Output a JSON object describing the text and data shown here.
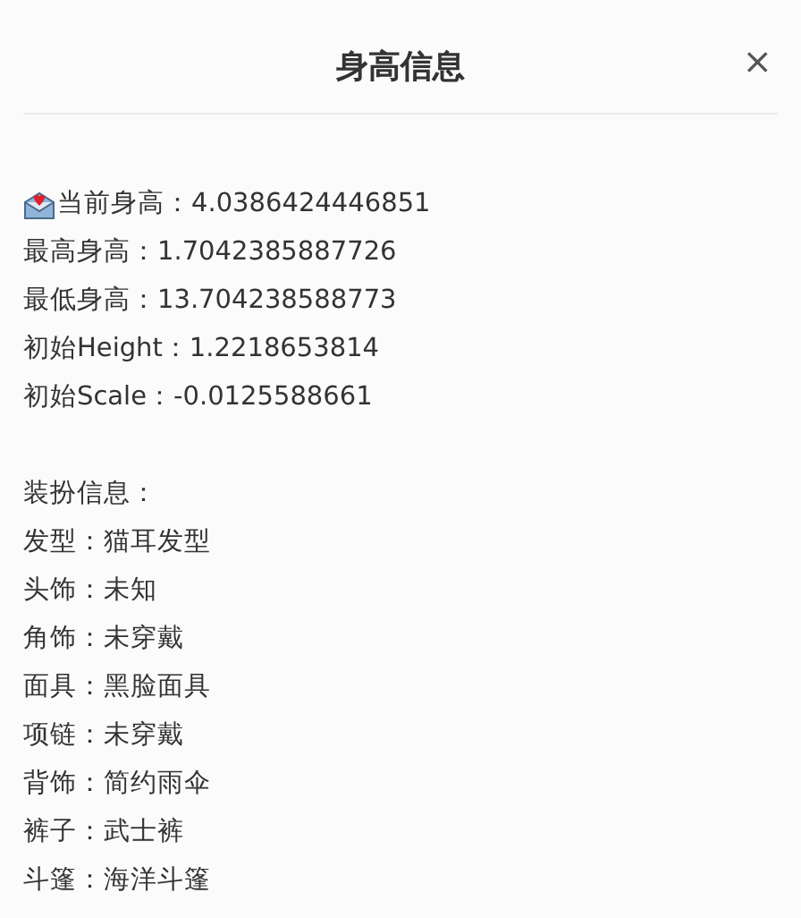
{
  "dialog": {
    "title": "身高信息",
    "close": "×"
  },
  "height_lines": [
    {
      "kind": "icon",
      "text": "当前身高：4.0386424446851"
    },
    {
      "kind": "plain",
      "text": "最高身高：1.7042385887726"
    },
    {
      "kind": "plain",
      "text": "最低身高：13.704238588773"
    },
    {
      "kind": "plain",
      "text": "初始Height：1.2218653814"
    },
    {
      "kind": "plain",
      "text": "初始Scale：-0.0125588661"
    }
  ],
  "outfit": {
    "heading": "装扮信息：",
    "lines": [
      "发型：猫耳发型",
      "头饰：未知",
      "角饰：未穿戴",
      "面具：黑脸面具",
      "项链：未穿戴",
      "背饰：简约雨伞",
      "裤子：武士裤",
      "斗篷：海洋斗篷"
    ]
  }
}
